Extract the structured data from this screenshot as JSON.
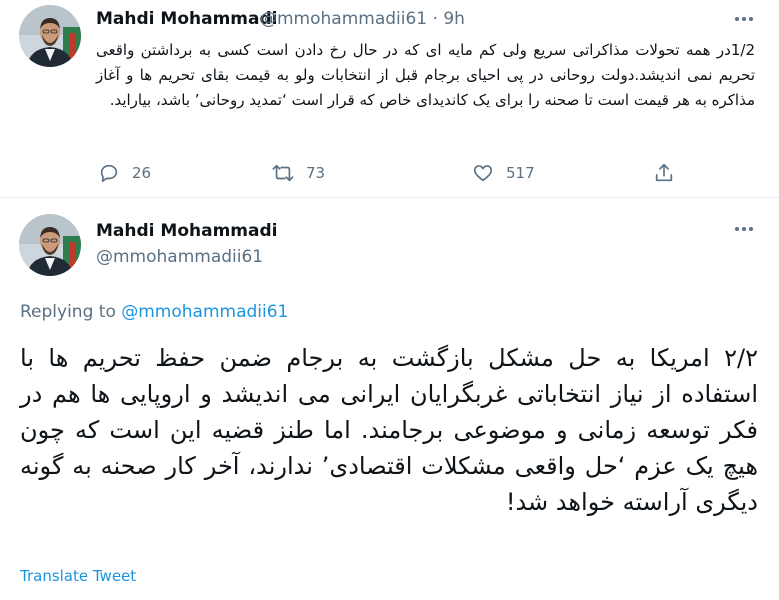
{
  "tweet1": {
    "name": "Mahdi Mohammadi",
    "handle": "@mmohammadii61",
    "separator": "·",
    "time": "9h",
    "text": "1/2در همه تحولات مذاکراتی سریع ولی کم مایه ای که در حال رخ دادن است کسی به برداشتن واقعی تحریم نمی اندیشد.دولت روحانی در پی احیای برجام قبل از انتخابات ولو به قیمت بقای تحریم ها و آغاز مذاکره به هر قیمت است تا صحنه را برای یک کاندیدای خاص که قرار است ‘تمدید روحانی’ باشد، بیاراید.",
    "actions": {
      "replies": "26",
      "retweets": "73",
      "likes": "517"
    },
    "icons": [
      "reply-icon",
      "retweet-icon",
      "like-icon",
      "share-icon",
      "more-icon"
    ]
  },
  "tweet2": {
    "name": "Mahdi Mohammadi",
    "handle": "@mmohammadii61",
    "replying_prefix": "Replying to ",
    "replying_to": "@mmohammadii61",
    "text": "۲/۲ امریکا به حل مشکل بازگشت به برجام ضمن حفظ تحریم ها با استفاده از نیاز انتخاباتی غربگرایان ایرانی می اندیشد و اروپایی ها هم در فکر توسعه زمانی و موضوعی برجامند. اما طنز قضیه این است که چون هیچ یک عزم ‘حل واقعی مشکلات اقتصادی’ ندارند، آخر کار صحنه به گونه دیگری آراسته خواهد شد!",
    "translate_label": "Translate Tweet"
  },
  "colors": {
    "text": "#0f1419",
    "muted": "#5b7083",
    "link": "#1b95e0",
    "divider": "#e6ecf0"
  }
}
